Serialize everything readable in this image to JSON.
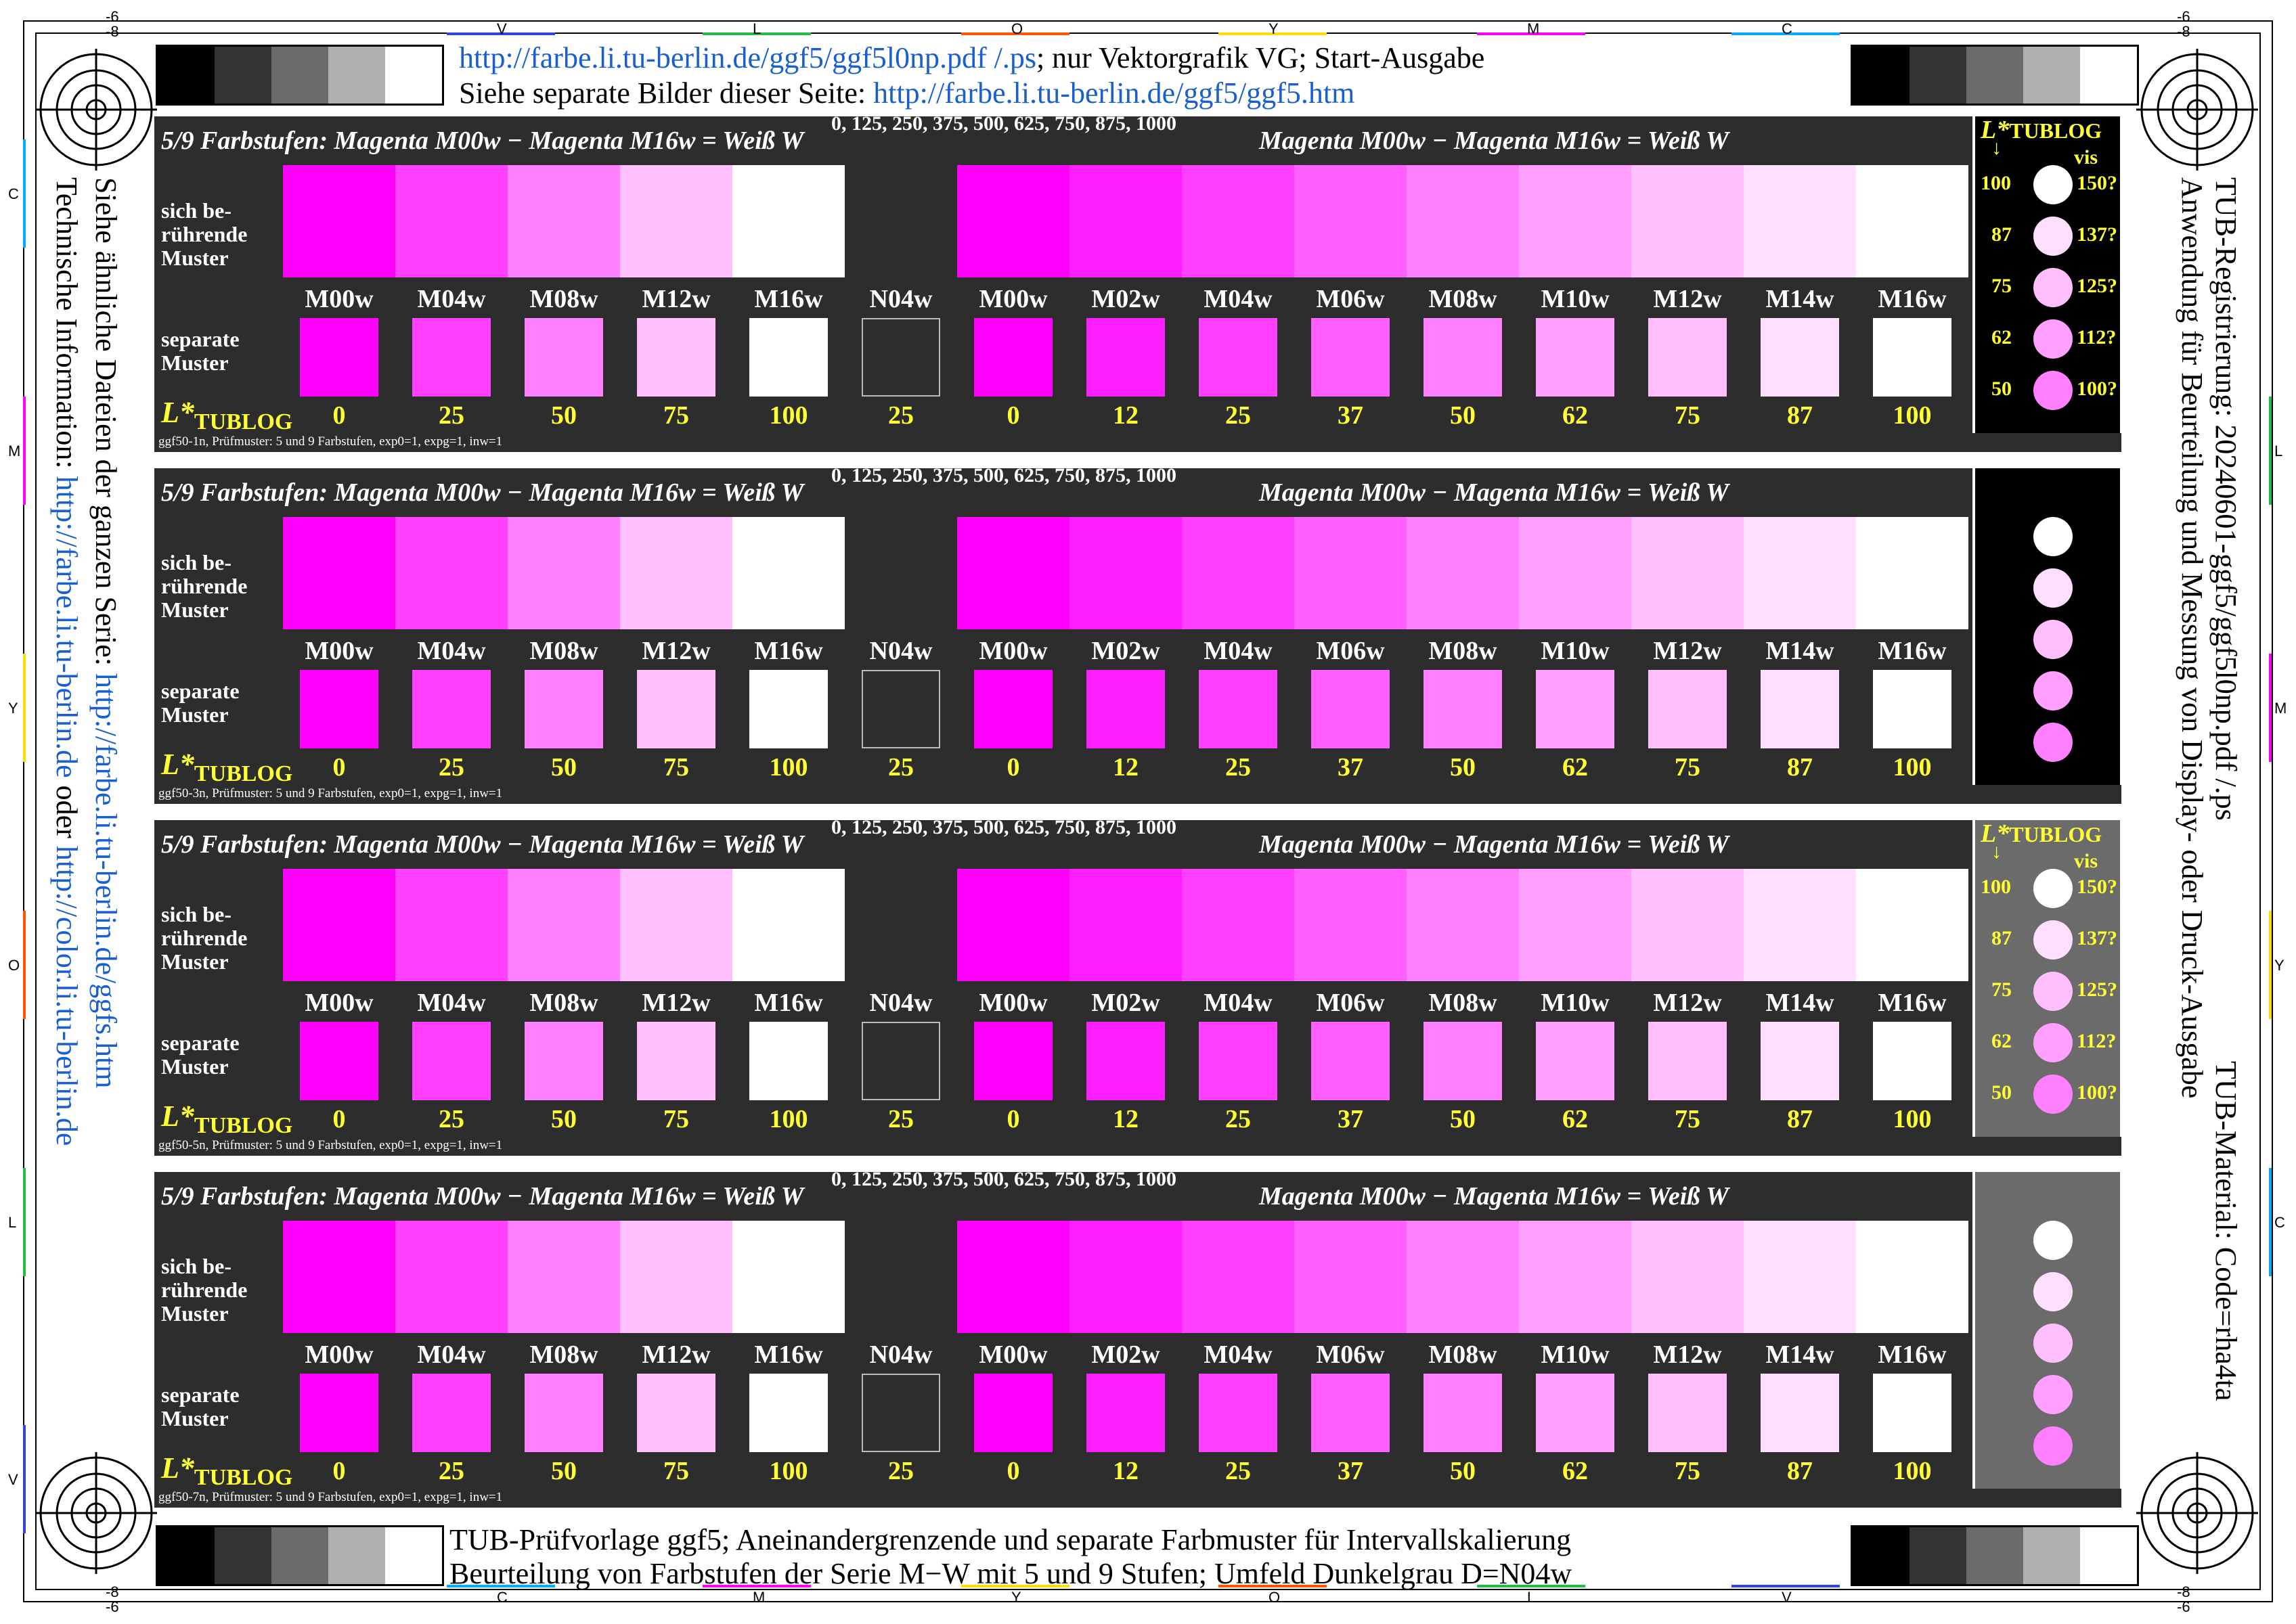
{
  "header": {
    "line1_link": "http://farbe.li.tu-berlin.de/ggf5/ggf5l0np.pdf /.ps",
    "line1_text": "; nur Vektorgrafik VG; Start-Ausgabe",
    "line2_text": "Siehe separate Bilder dieser Seite: ",
    "line2_link": "http://farbe.li.tu-berlin.de/ggf5/ggf5.htm"
  },
  "footer": {
    "line1": "TUB-Prüfvorlage ggf5; Aneinandergrenzende und separate Farbmuster für Intervallskalierung",
    "line2": "Beurteilung von Farbstufen der Serie M−W mit 5 und 9 Stufen; Umfeld Dunkelgrau D=N04w"
  },
  "left_side": {
    "line1_text": "Siehe ähnliche Dateien der ganzen Serie: ",
    "line1_link": "http://farbe.li.tu-berlin.de/ggfs.htm",
    "line2_text": "Technische Information: ",
    "line2_link": "http://farbe.li.tu-berlin.de",
    "line2_mid": " oder ",
    "line2_link2": "http://color.li.tu-berlin.de"
  },
  "right_side": {
    "line1": "TUB-Registrierung: 20240601-ggf5/ggf5l0np.pdf /.ps",
    "line2": "Anwendung für Beurteilung und Messung von Display- oder Druck-Ausgabe",
    "line3": "TUB-Material: Code=rha4ta"
  },
  "edge_labels": {
    "top": [
      "V",
      "L",
      "O",
      "Y",
      "M",
      "C"
    ],
    "bottom": [
      "C",
      "M",
      "Y",
      "O",
      "L",
      "V"
    ],
    "left": [
      "C",
      "M",
      "Y",
      "O",
      "L",
      "V"
    ],
    "right": [
      "L",
      "M",
      "Y",
      "C"
    ],
    "corner_top_left": [
      "-6",
      "-8"
    ],
    "corner_top_right": [
      "-6",
      "-8"
    ],
    "corner_bottom_left": [
      "-8",
      "-6"
    ],
    "corner_bottom_right": [
      "-8",
      "-6"
    ]
  },
  "panel_common": {
    "title_left": "5/9 Farbstufen:  Magenta M00w − Magenta M16w = Weiß W",
    "title_right": "Magenta M00w − Magenta M16w = Weiß W",
    "scale_text": "0, 125, 250, 375, 500, 625, 750, 875, 1000",
    "label_touching_1": "sich be-",
    "label_touching_2": "rührende",
    "label_touching_3": "Muster",
    "label_separate_1": "separate",
    "label_separate_2": "Muster",
    "ltublog_L": "L*",
    "ltublog_sub": "TUBLOG",
    "codes": [
      "M00w",
      "M04w",
      "M08w",
      "M12w",
      "M16w",
      "N04w",
      "M00w",
      "M02w",
      "M04w",
      "M06w",
      "M08w",
      "M10w",
      "M12w",
      "M14w",
      "M16w"
    ],
    "values": [
      "0",
      "25",
      "50",
      "75",
      "100",
      "25",
      "0",
      "12",
      "25",
      "37",
      "50",
      "62",
      "75",
      "87",
      "100"
    ],
    "colors": [
      "#ff00ff",
      "#ff40ff",
      "#ff80ff",
      "#ffbfff",
      "#ffffff",
      "#2d2d2d",
      "#ff00ff",
      "#ff20ff",
      "#ff40ff",
      "#ff60ff",
      "#ff80ff",
      "#ff9fff",
      "#ffbfff",
      "#ffdfff",
      "#ffffff"
    ]
  },
  "panels": [
    {
      "footnote": "ggf50-1n, Prüfmuster: 5 und 9 Farbstufen, exp0=1, expg=1, inw=1",
      "side_bg": "#000000",
      "legend": true
    },
    {
      "footnote": "ggf50-3n, Prüfmuster: 5 und 9 Farbstufen, exp0=1, expg=1, inw=1",
      "side_bg": "#000000",
      "legend": false
    },
    {
      "footnote": "ggf50-5n, Prüfmuster: 5 und 9 Farbstufen, exp0=1, expg=1, inw=1",
      "side_bg": "#6b6b6b",
      "legend": true
    },
    {
      "footnote": "ggf50-7n, Prüfmuster: 5 und 9 Farbstufen, exp0=1, expg=1, inw=1",
      "side_bg": "#6b6b6b",
      "legend": false
    }
  ],
  "legend": {
    "title_L": "L*",
    "title_sub": "TUBLOG",
    "arrow": "↓",
    "vis": "vis",
    "rows": [
      {
        "l": "100",
        "v": "150?",
        "color": "#ffffff"
      },
      {
        "l": "87",
        "v": "137?",
        "color": "#ffdfff"
      },
      {
        "l": "75",
        "v": "125?",
        "color": "#ffbfff"
      },
      {
        "l": "62",
        "v": "112?",
        "color": "#ff9fff"
      },
      {
        "l": "50",
        "v": "100?",
        "color": "#ff80ff"
      }
    ]
  },
  "gray_steps": [
    "#000000",
    "#333333",
    "#6b6b6b",
    "#b0b0b0",
    "#ffffff"
  ]
}
